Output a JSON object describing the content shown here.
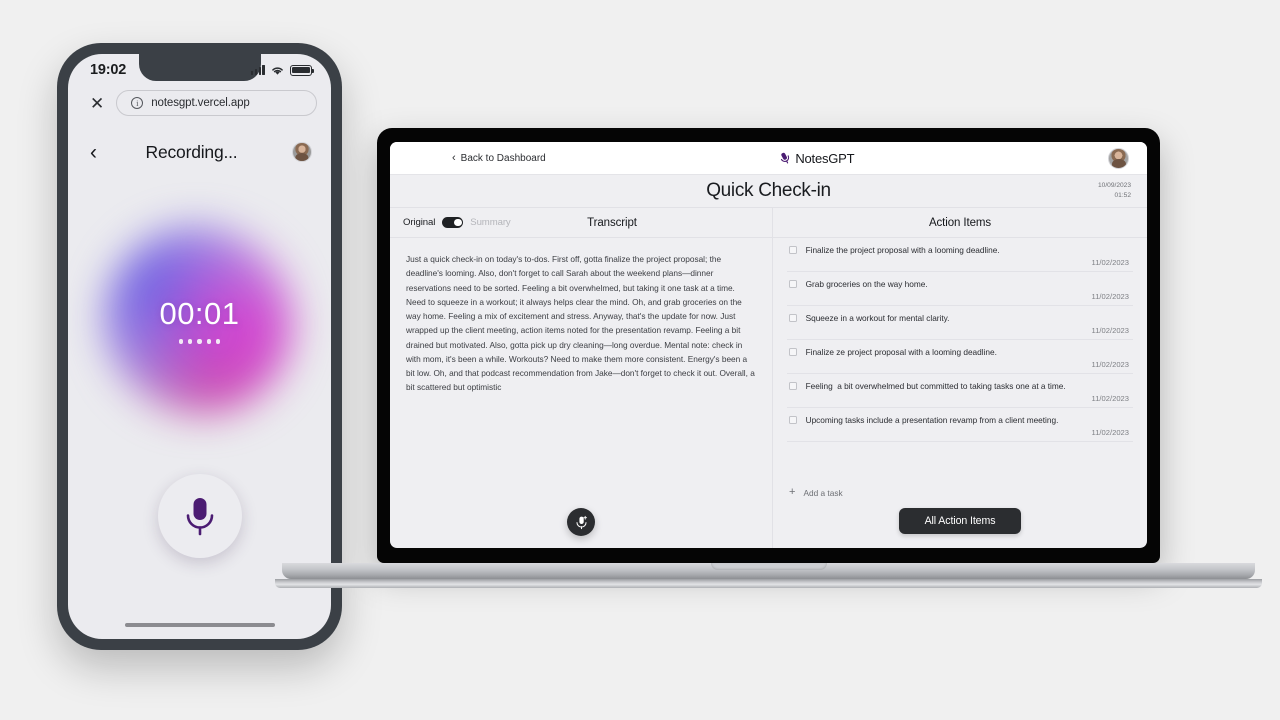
{
  "phone": {
    "status": {
      "time": "19:02",
      "signal_icon": "signal-bars-icon",
      "wifi_icon": "wifi-icon",
      "battery_icon": "battery-icon"
    },
    "browser": {
      "close_icon": "close-icon",
      "info_icon": "info-circle-icon",
      "url": "notesgpt.vercel.app"
    },
    "nav": {
      "back_icon": "chevron-left-icon",
      "title": "Recording...",
      "avatar_icon": "user-avatar"
    },
    "recorder": {
      "timer": "00:01",
      "dot_count": 5,
      "mic_icon": "microphone-icon",
      "gradient": {
        "blue": "#6860e2",
        "magenta": "#d63cd2",
        "pink": "#c9408b",
        "violet": "#a868e4"
      }
    }
  },
  "laptop": {
    "top_bar": {
      "back_icon": "chevron-left-icon",
      "back_label": "Back to Dashboard",
      "brand_icon": "microphone-icon",
      "brand_name": "NotesGPT",
      "avatar_icon": "user-avatar"
    },
    "note": {
      "title": "Quick Check-in",
      "date": "10/09/2023",
      "time": "01:52"
    },
    "left_panel": {
      "toggle_original": "Original",
      "toggle_summary": "Summary",
      "toggle_state": "original",
      "header": "Transcript",
      "transcript": "Just a quick check-in on today's to-dos. First off, gotta finalize the project proposal; the deadline's looming. Also, don't forget to call Sarah about the weekend plans—dinner reservations need to be sorted. Feeling a bit overwhelmed, but taking it one task at a time. Need to squeeze in a workout; it always helps clear the mind. Oh, and grab groceries on the way home. Feeling a mix of excitement and stress. Anyway, that's the update for now. Just wrapped up the client meeting, action items noted for the presentation revamp. Feeling a bit drained but motivated. Also, gotta pick up dry cleaning—long overdue. Mental note: check in with mom, it's been a while. Workouts? Need to make them more consistent. Energy's been a bit low. Oh, and that podcast recommendation from Jake—don't forget to check it out. Overall, a bit scattered but optimistic",
      "float_mic_icon": "microphone-add-icon"
    },
    "right_panel": {
      "header": "Action Items",
      "items": [
        {
          "text": "Finalize the project proposal with a looming deadline.",
          "date": "11/02/2023",
          "checked": false
        },
        {
          "text": "Grab groceries on the way home.",
          "date": "11/02/2023",
          "checked": false
        },
        {
          "text": "Squeeze in a workout for mental clarity.",
          "date": "11/02/2023",
          "checked": false
        },
        {
          "text": "Finalize ze project proposal with a looming deadline.",
          "date": "11/02/2023",
          "checked": false
        },
        {
          "text": "Feeling  a bit overwhelmed but committed to taking tasks one at a time.",
          "date": "11/02/2023",
          "checked": false
        },
        {
          "text": "Upcoming tasks include a presentation revamp from a client meeting.",
          "date": "11/02/2023",
          "checked": false
        }
      ],
      "add_task_icon": "plus-icon",
      "add_task_label": "Add a task",
      "all_action_items_button": "All Action Items"
    }
  },
  "theme": {
    "accent_purple": "#4b1c72",
    "dark_button": "#2b2d30",
    "page_background": "#f0f0f0",
    "screen_background": "#efeff2"
  }
}
